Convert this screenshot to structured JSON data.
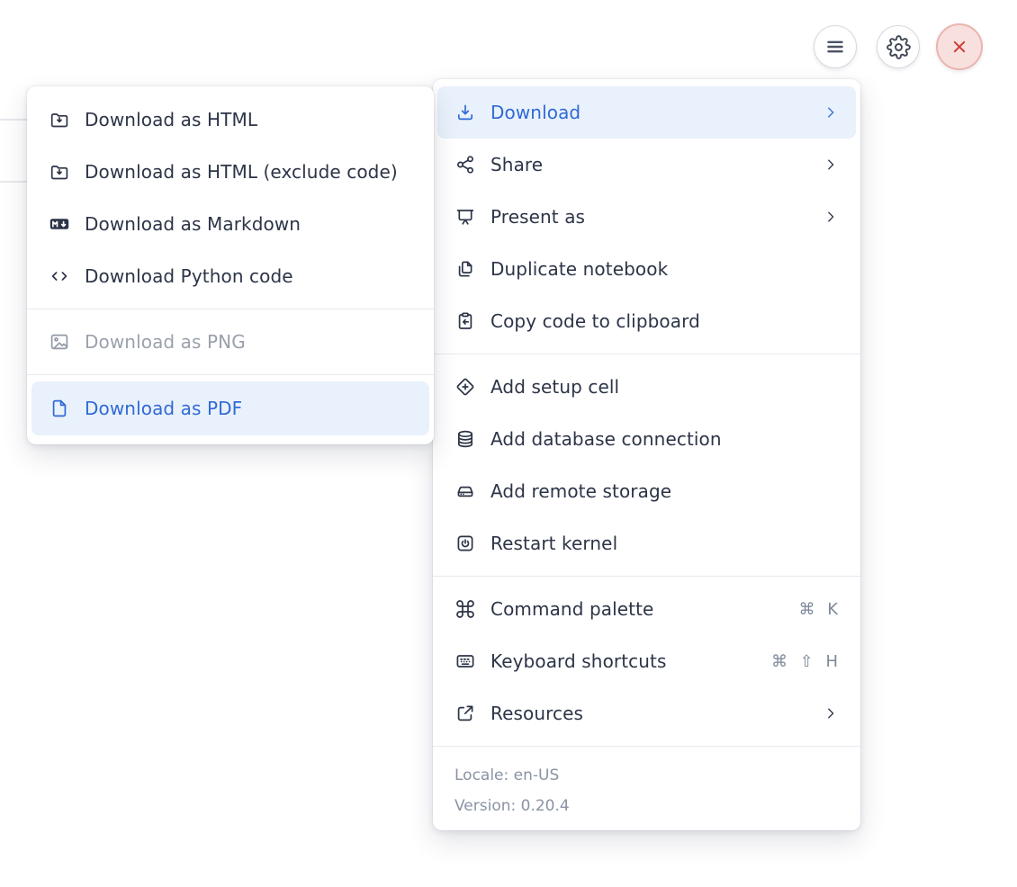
{
  "colors": {
    "accent_blue": "#3169d6",
    "accent_blue_bg": "#e9f1fc",
    "text_dark": "#2c3447",
    "disabled_gray": "#9aa1ac",
    "danger_red": "#d03c35",
    "footer_gray": "#8a93a4"
  },
  "header": {
    "buttons": [
      {
        "name": "menu",
        "icon": "hamburger-icon"
      },
      {
        "name": "settings",
        "icon": "gear-icon"
      },
      {
        "name": "close",
        "icon": "close-icon"
      }
    ]
  },
  "download_submenu": {
    "sections": [
      {
        "items": [
          {
            "label": "Download as HTML",
            "icon": "folder-download-icon",
            "state": "normal"
          },
          {
            "label": "Download as HTML (exclude code)",
            "icon": "folder-download-icon",
            "state": "normal"
          },
          {
            "label": "Download as Markdown",
            "icon": "markdown-icon",
            "state": "normal"
          },
          {
            "label": "Download Python code",
            "icon": "code-icon",
            "state": "normal"
          }
        ]
      },
      {
        "items": [
          {
            "label": "Download as PNG",
            "icon": "image-icon",
            "state": "disabled"
          }
        ]
      },
      {
        "items": [
          {
            "label": "Download as PDF",
            "icon": "file-pdf-icon",
            "state": "highlighted"
          }
        ]
      }
    ]
  },
  "main_menu": {
    "sections": [
      {
        "items": [
          {
            "label": "Download",
            "icon": "download-icon",
            "state": "highlighted",
            "submenu": true
          },
          {
            "label": "Share",
            "icon": "share-icon",
            "state": "normal",
            "submenu": true
          },
          {
            "label": "Present as",
            "icon": "present-icon",
            "state": "normal",
            "submenu": true
          },
          {
            "label": "Duplicate notebook",
            "icon": "duplicate-icon",
            "state": "normal"
          },
          {
            "label": "Copy code to clipboard",
            "icon": "clipboard-paste-icon",
            "state": "normal"
          }
        ]
      },
      {
        "items": [
          {
            "label": "Add setup cell",
            "icon": "diamond-plus-icon",
            "state": "normal"
          },
          {
            "label": "Add database connection",
            "icon": "database-icon",
            "state": "normal"
          },
          {
            "label": "Add remote storage",
            "icon": "hard-drive-icon",
            "state": "normal"
          },
          {
            "label": "Restart kernel",
            "icon": "power-square-icon",
            "state": "normal"
          }
        ]
      },
      {
        "items": [
          {
            "label": "Command palette",
            "icon": "command-icon",
            "state": "normal",
            "shortcut": "⌘ K"
          },
          {
            "label": "Keyboard shortcuts",
            "icon": "keyboard-icon",
            "state": "normal",
            "shortcut": "⌘ ⇧ H"
          },
          {
            "label": "Resources",
            "icon": "external-link-icon",
            "state": "normal",
            "submenu": true
          }
        ]
      }
    ],
    "footer": {
      "locale": "Locale: en-US",
      "version": "Version: 0.20.4"
    }
  }
}
